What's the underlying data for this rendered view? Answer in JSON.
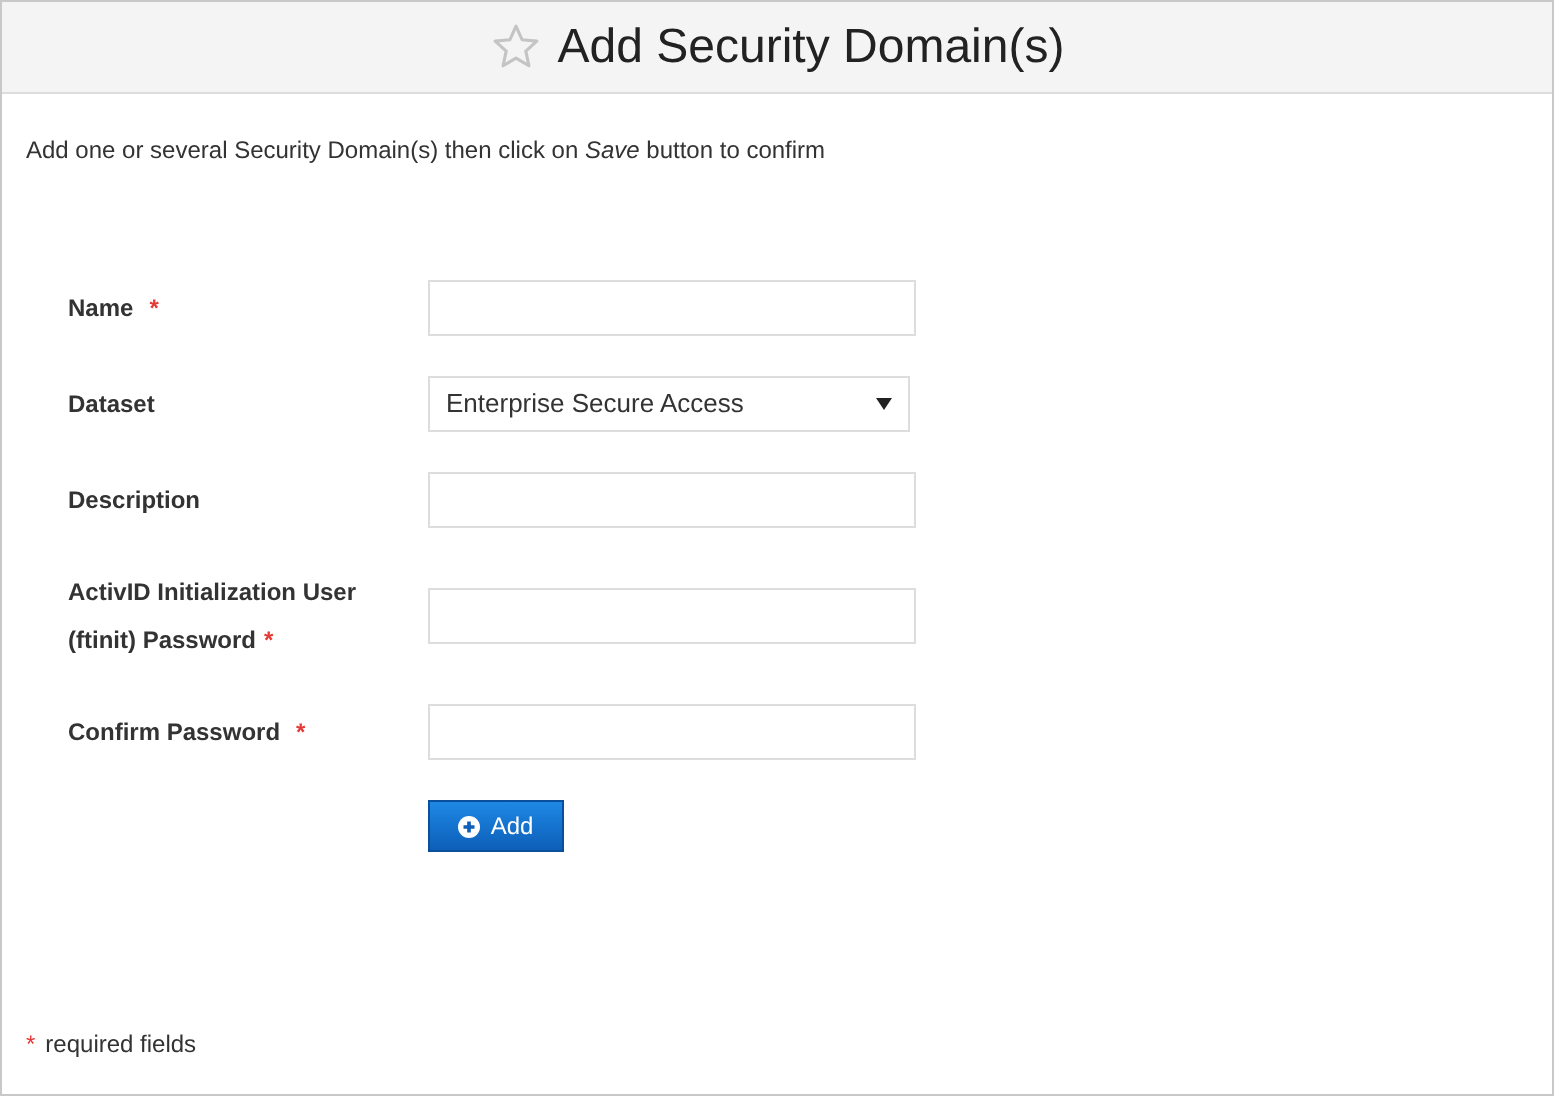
{
  "header": {
    "title": "Add Security Domain(s)"
  },
  "intro": "Add one or several Security Domain(s) then click on *Save* button to confirm",
  "fields": [
    {
      "kind": "text",
      "label": "Name",
      "required_mark": "*"
    },
    {
      "kind": "select",
      "label": "Dataset",
      "value": "Enterprise Secure Access"
    },
    {
      "kind": "text",
      "label": "Description"
    },
    {
      "kind": "text",
      "label": "ActivID Initialization User (ftinit) Password",
      "required_mark": "*"
    },
    {
      "kind": "text",
      "label": "Confirm Password",
      "required_mark": "*"
    }
  ],
  "add_button": {
    "label": "Add"
  },
  "footer": {
    "mark": "*",
    "text": "required fields"
  }
}
